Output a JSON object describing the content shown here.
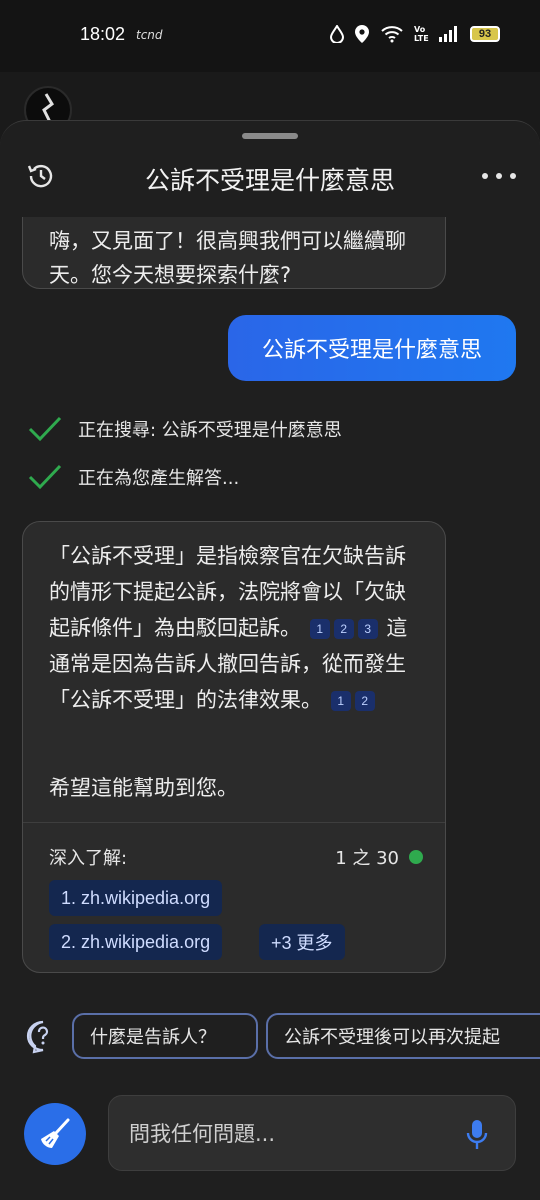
{
  "status_bar": {
    "time": "18:02",
    "carrier": "tcnd",
    "battery": "93",
    "volte": "Vo LTE",
    "icons": [
      "drop-icon",
      "location-icon",
      "wifi-icon",
      "volte-icon",
      "signal-icon",
      "battery-icon"
    ]
  },
  "header": {
    "title": "公訴不受理是什麼意思",
    "history_icon": "history-icon",
    "more_icon": "more-icon"
  },
  "chat": {
    "previous_bot_message": "嗨，又見面了！很高興我們可以繼續聊天。您今天想要探索什麼?",
    "user_message": "公訴不受理是什麼意思",
    "status_search": "正在搜尋: 公訴不受理是什麼意思",
    "status_generate": "正在為您產生解答...",
    "answer": {
      "part1": "「公訴不受理」是指檢察官在欠缺告訴的情形下提起公訴，法院將會以「欠缺起訴條件」為由駁回起訴。",
      "cites_a": [
        "1",
        "2",
        "3"
      ],
      "part2": "這通常是因為告訴人撤回告訴，從而發生「公訴不受理」的法律效果。",
      "cites_b": [
        "1",
        "2"
      ],
      "closing": "希望這能幫助到您。"
    },
    "learn_more_label": "深入了解:",
    "counter": "1 之 30",
    "sources": [
      "1. zh.wikipedia.org",
      "2. zh.wikipedia.org"
    ],
    "more_sources": "+3 更多"
  },
  "suggestions": {
    "help_icon": "question-bubble-icon",
    "items": [
      "什麼是告訴人？",
      "公訴不受理後可以再次提起"
    ]
  },
  "input": {
    "placeholder": "問我任何問題...",
    "new_topic_icon": "broom-icon",
    "mic_icon": "mic-icon"
  },
  "colors": {
    "accent": "#2a6ee8",
    "check": "#2faa4e",
    "chip_border": "#5a6fa8",
    "citation_bg": "#1a2f6b"
  }
}
